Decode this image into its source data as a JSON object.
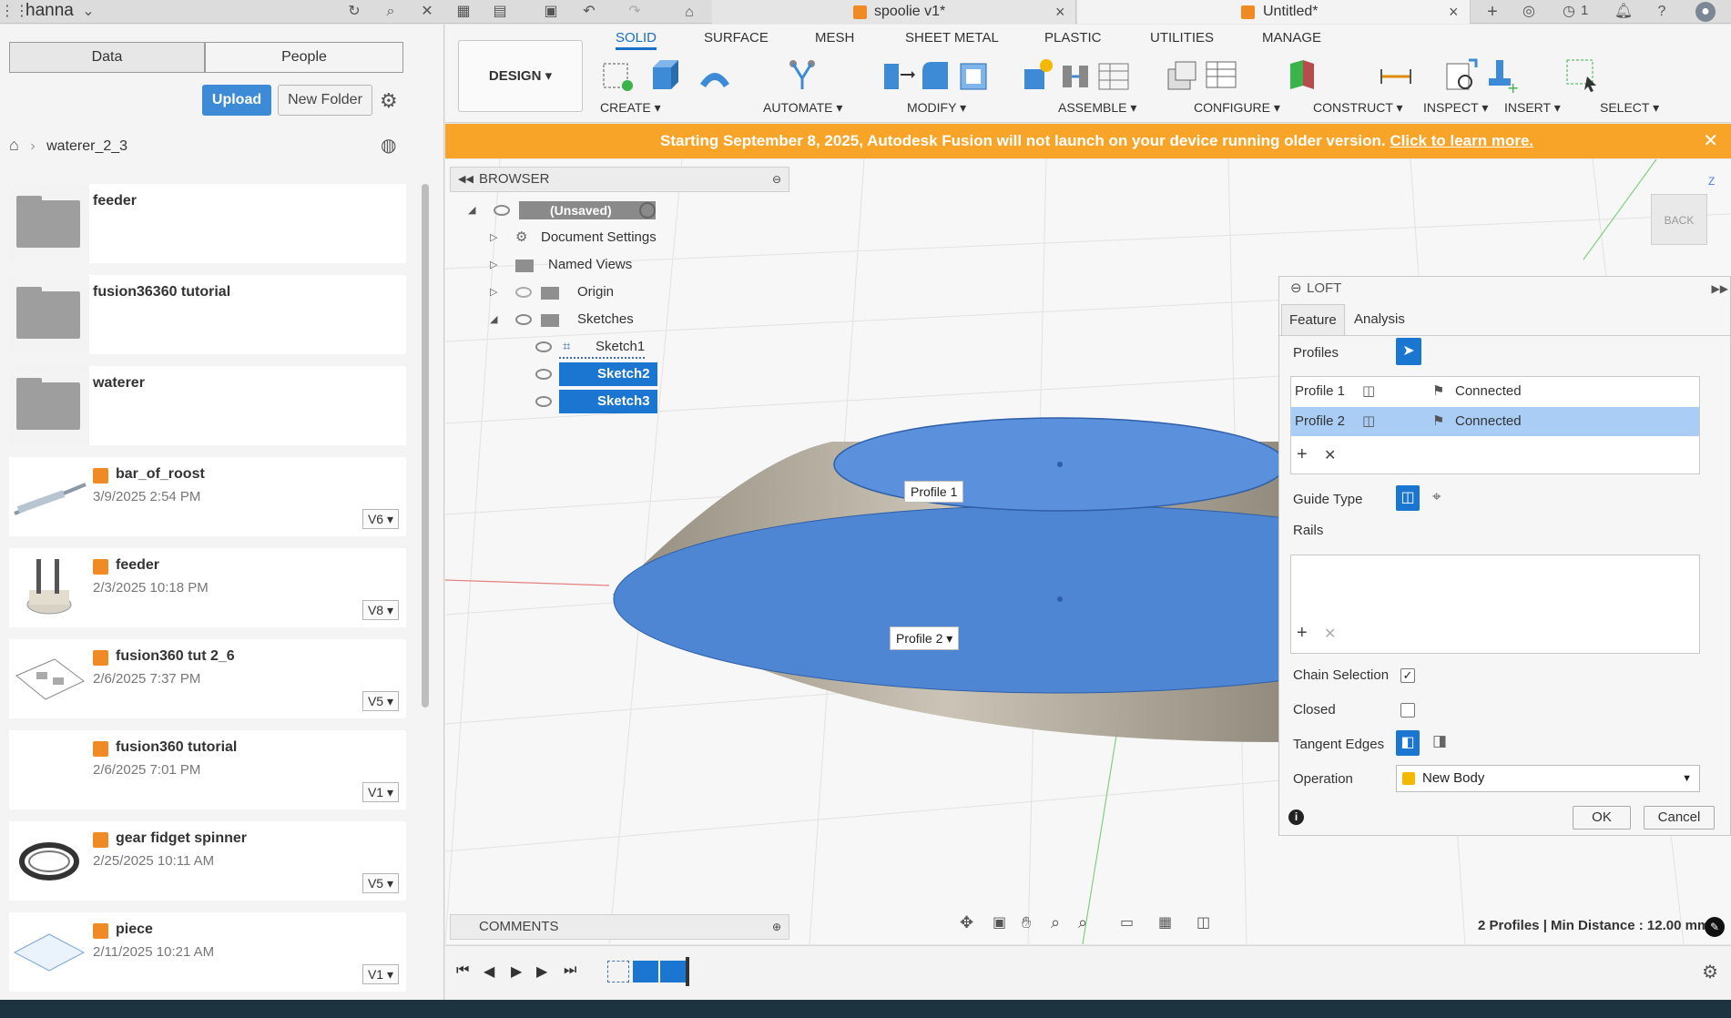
{
  "titlebar": {
    "user": "hanna",
    "tabs": [
      {
        "label": "spoolie v1*"
      },
      {
        "label": "Untitled*"
      }
    ],
    "job_count": "1"
  },
  "data_panel": {
    "tab_data": "Data",
    "tab_people": "People",
    "upload_label": "Upload",
    "new_folder_label": "New Folder",
    "breadcrumb": "waterer_2_3",
    "items": [
      {
        "name": "feeder",
        "type": "folder"
      },
      {
        "name": "fusion36360 tutorial",
        "type": "folder"
      },
      {
        "name": "waterer",
        "type": "folder"
      },
      {
        "name": "bar_of_roost",
        "date": "3/9/2025 2:54 PM",
        "version": "V6"
      },
      {
        "name": "feeder",
        "date": "2/3/2025 10:18 PM",
        "version": "V8"
      },
      {
        "name": "fusion360 tut 2_6",
        "date": "2/6/2025 7:37 PM",
        "version": "V5"
      },
      {
        "name": "fusion360 tutorial",
        "date": "2/6/2025 7:01 PM",
        "version": "V1"
      },
      {
        "name": "gear fidget spinner",
        "date": "2/25/2025 10:11 AM",
        "version": "V5"
      },
      {
        "name": "piece",
        "date": "2/11/2025 10:21 AM",
        "version": "V1"
      }
    ]
  },
  "toolbar": {
    "workspace": "DESIGN",
    "tabs": [
      "SOLID",
      "SURFACE",
      "MESH",
      "SHEET METAL",
      "PLASTIC",
      "UTILITIES",
      "MANAGE"
    ],
    "groups": [
      "CREATE",
      "AUTOMATE",
      "MODIFY",
      "ASSEMBLE",
      "CONFIGURE",
      "CONSTRUCT",
      "INSPECT",
      "INSERT",
      "SELECT"
    ]
  },
  "banner": {
    "message": "Starting September 8, 2025, Autodesk Fusion will not launch on your device running older version.",
    "link": "Click to learn more."
  },
  "browser": {
    "title": "BROWSER",
    "root": "(Unsaved)",
    "nodes": [
      "Document Settings",
      "Named Views",
      "Origin",
      "Sketches"
    ],
    "sketches": [
      "Sketch1",
      "Sketch2",
      "Sketch3"
    ]
  },
  "viewcube": {
    "face": "BACK",
    "axis": "Z"
  },
  "canvas": {
    "profile1_label": "Profile 1",
    "profile2_label": "Profile 2"
  },
  "loft": {
    "title": "LOFT",
    "tab_feature": "Feature",
    "tab_analysis": "Analysis",
    "profiles_label": "Profiles",
    "profiles": [
      {
        "name": "Profile 1",
        "status": "Connected"
      },
      {
        "name": "Profile 2",
        "status": "Connected"
      }
    ],
    "guide_type_label": "Guide Type",
    "rails_label": "Rails",
    "chain_selection_label": "Chain Selection",
    "chain_selection_checked": true,
    "closed_label": "Closed",
    "closed_checked": false,
    "tangent_edges_label": "Tangent Edges",
    "operation_label": "Operation",
    "operation_value": "New Body",
    "ok_label": "OK",
    "cancel_label": "Cancel"
  },
  "comments_label": "COMMENTS",
  "status_text": "2 Profiles | Min Distance : 12.00 mm",
  "colors": {
    "accent": "#1a76d1",
    "banner": "#f8a428",
    "profile_fill": "#4f86d4",
    "upload": "#3d8bd6"
  }
}
